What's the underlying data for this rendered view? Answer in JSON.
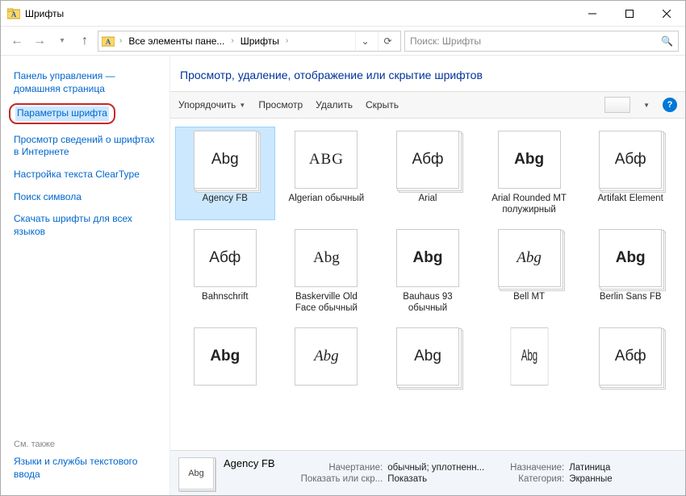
{
  "window": {
    "title": "Шрифты"
  },
  "nav": {
    "crumb1": "Все элементы пане...",
    "crumb2": "Шрифты",
    "search_placeholder": "Поиск: Шрифты"
  },
  "sidebar": {
    "home": "Панель управления — домашняя страница",
    "font_params": "Параметры шрифта",
    "font_info_web": "Просмотр сведений о шрифтах в Интернете",
    "cleartype": "Настройка текста ClearType",
    "find_char": "Поиск символа",
    "download_fonts": "Скачать шрифты для всех языков",
    "see_also": "См. также",
    "text_services": "Языки и службы текстового ввода"
  },
  "heading": "Просмотр, удаление, отображение или скрытие шрифтов",
  "toolbar": {
    "organize": "Упорядочить",
    "preview": "Просмотр",
    "delete": "Удалить",
    "hide": "Скрыть"
  },
  "fonts": [
    {
      "sample": "Abg",
      "label": "Agency FB",
      "selected": true,
      "stack": true,
      "style": "font-family:'Agency FB',sans-serif;font-stretch:condensed"
    },
    {
      "sample": "ABG",
      "label": "Algerian обычный",
      "stack": false,
      "style": "font-family:Algerian,serif;letter-spacing:1px"
    },
    {
      "sample": "Абф",
      "label": "Arial",
      "stack": true,
      "style": "font-family:Arial"
    },
    {
      "sample": "Abg",
      "label": "Arial Rounded MT полужирный",
      "stack": false,
      "style": "font-family:'Arial Rounded MT Bold',Arial;font-weight:bold"
    },
    {
      "sample": "Абф",
      "label": "Artifakt Element",
      "stack": true,
      "style": "font-family:Arial"
    },
    {
      "sample": "Абф",
      "label": "Bahnschrift",
      "stack": false,
      "style": "font-family:Bahnschrift,Arial"
    },
    {
      "sample": "Abg",
      "label": "Baskerville Old Face обычный",
      "stack": false,
      "style": "font-family:'Baskerville Old Face',serif"
    },
    {
      "sample": "Abg",
      "label": "Bauhaus 93 обычный",
      "stack": false,
      "style": "font-family:'Bauhaus 93',sans-serif;font-weight:900"
    },
    {
      "sample": "Abg",
      "label": "Bell MT",
      "stack": true,
      "style": "font-family:'Bell MT',serif;font-style:italic"
    },
    {
      "sample": "Abg",
      "label": "Berlin Sans FB",
      "stack": true,
      "style": "font-family:'Berlin Sans FB',sans-serif;font-weight:bold"
    },
    {
      "sample": "Abg",
      "label": "",
      "stack": false,
      "style": "font-family:Arial;font-weight:900"
    },
    {
      "sample": "Abg",
      "label": "",
      "stack": false,
      "style": "font-family:'Brush Script MT',cursive;font-style:italic"
    },
    {
      "sample": "Abg",
      "label": "",
      "stack": true,
      "style": "font-family:Arial"
    },
    {
      "sample": "Abg",
      "label": "",
      "stack": false,
      "style": "font-family:Arial;font-stretch:ultra-condensed;transform:scaleX(0.6)"
    },
    {
      "sample": "Абф",
      "label": "",
      "stack": true,
      "style": "font-family:Arial"
    }
  ],
  "details": {
    "name": "Agency FB",
    "style_k": "Начертание:",
    "style_v": "обычный; уплотненн...",
    "show_k": "Показать или скр...",
    "show_v": "Показать",
    "purpose_k": "Назначение:",
    "purpose_v": "Латиница",
    "category_k": "Категория:",
    "category_v": "Экранные",
    "icon_sample": "Abg"
  }
}
